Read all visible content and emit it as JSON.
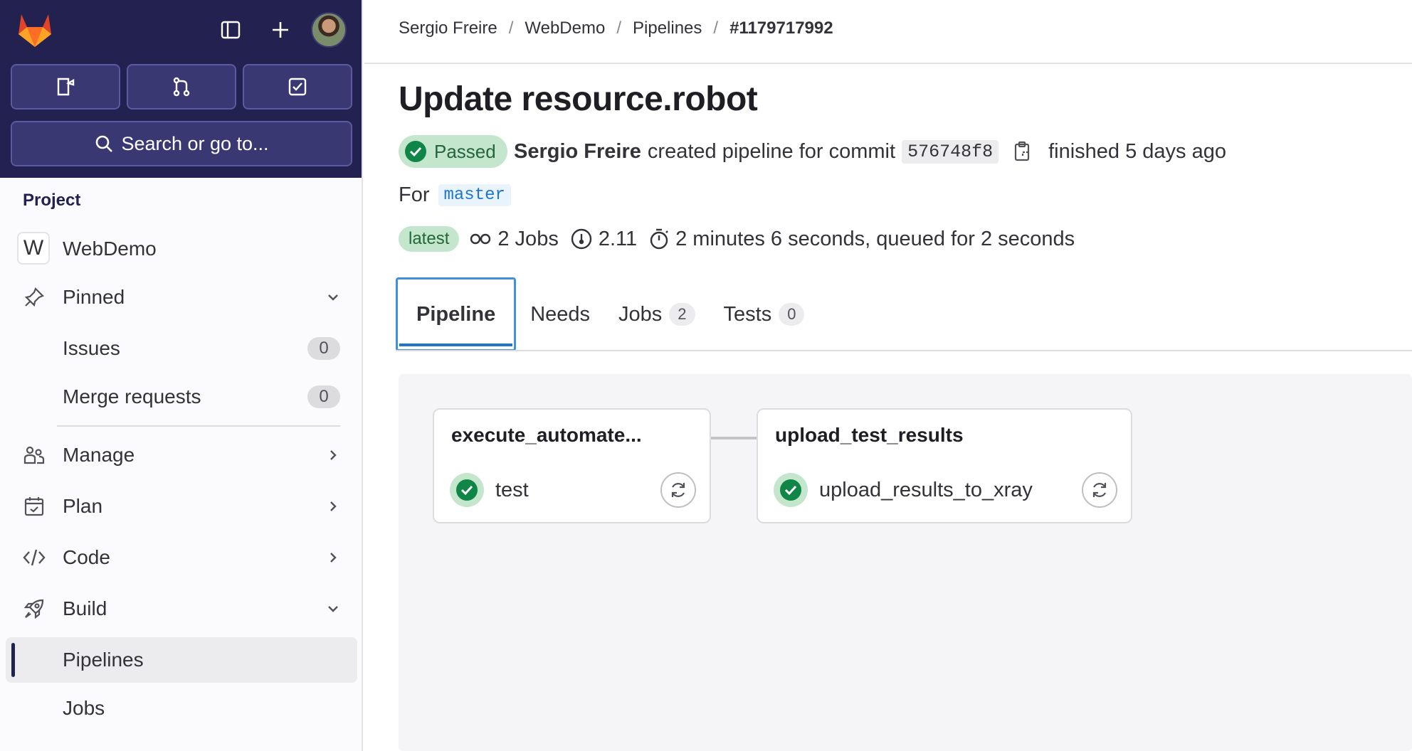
{
  "sidebar": {
    "search_label": "Search or go to...",
    "section_label": "Project",
    "project_initial": "W",
    "project_name": "WebDemo",
    "items": [
      {
        "label": "Pinned"
      },
      {
        "label": "Issues",
        "count": "0"
      },
      {
        "label": "Merge requests",
        "count": "0"
      },
      {
        "label": "Manage"
      },
      {
        "label": "Plan"
      },
      {
        "label": "Code"
      },
      {
        "label": "Build"
      },
      {
        "label": "Pipelines"
      },
      {
        "label": "Jobs"
      }
    ]
  },
  "breadcrumb": [
    "Sergio Freire",
    "WebDemo",
    "Pipelines",
    "#1179717992"
  ],
  "pipeline": {
    "title": "Update resource.robot",
    "status": "Passed",
    "author": "Sergio Freire",
    "created_text": "created pipeline for commit",
    "commit_sha": "576748f8",
    "finished_text": "finished 5 days ago",
    "for_label": "For",
    "branch": "master",
    "tag": "latest",
    "jobs_count_text": "2 Jobs",
    "compute_text": "2.11",
    "duration_text": "2 minutes 6 seconds, queued for 2 seconds"
  },
  "tabs": [
    {
      "label": "Pipeline"
    },
    {
      "label": "Needs"
    },
    {
      "label": "Jobs",
      "count": "2"
    },
    {
      "label": "Tests",
      "count": "0"
    }
  ],
  "stages": [
    {
      "title": "execute_automate...",
      "job": "test"
    },
    {
      "title": "upload_test_results",
      "job": "upload_results_to_xray"
    }
  ],
  "colors": {
    "sidebar_header": "#232150",
    "success": "#108548",
    "success_bg": "#c3e6cd",
    "link": "#1f75cb"
  }
}
